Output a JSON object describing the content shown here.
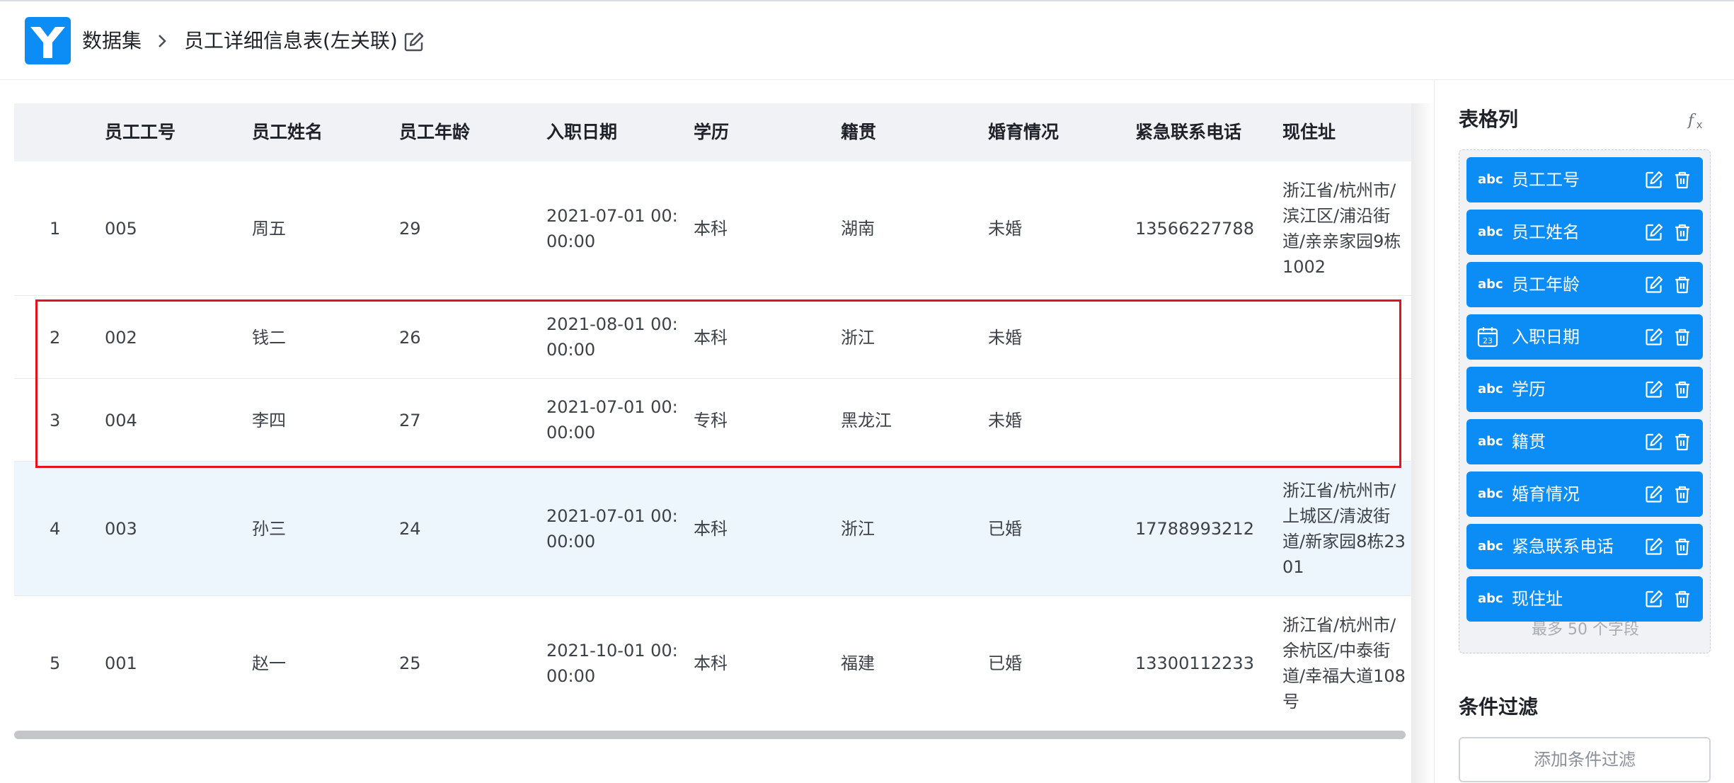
{
  "breadcrumb": {
    "root": "数据集",
    "title": "员工详细信息表(左关联)"
  },
  "table": {
    "columns": [
      "员工工号",
      "员工姓名",
      "员工年龄",
      "入职日期",
      "学历",
      "籍贯",
      "婚育情况",
      "紧急联系电话",
      "现住址"
    ],
    "rows": [
      {
        "index": "1",
        "id": "005",
        "name": "周五",
        "age": "29",
        "date": [
          "2021-07-01 00:",
          "00:00"
        ],
        "edu": "本科",
        "origin": "湖南",
        "marital": "未婚",
        "phone": "13566227788",
        "address": [
          "浙江省/杭州市/",
          "滨江区/浦沿街",
          "道/亲亲家园9栋",
          "1002"
        ],
        "highlighted": false
      },
      {
        "index": "2",
        "id": "002",
        "name": "钱二",
        "age": "26",
        "date": [
          "2021-08-01 00:",
          "00:00"
        ],
        "edu": "本科",
        "origin": "浙江",
        "marital": "未婚",
        "phone": "",
        "address": [],
        "highlighted": false
      },
      {
        "index": "3",
        "id": "004",
        "name": "李四",
        "age": "27",
        "date": [
          "2021-07-01 00:",
          "00:00"
        ],
        "edu": "专科",
        "origin": "黑龙江",
        "marital": "未婚",
        "phone": "",
        "address": [],
        "highlighted": false
      },
      {
        "index": "4",
        "id": "003",
        "name": "孙三",
        "age": "24",
        "date": [
          "2021-07-01 00:",
          "00:00"
        ],
        "edu": "本科",
        "origin": "浙江",
        "marital": "已婚",
        "phone": "17788993212",
        "address": [
          "浙江省/杭州市/",
          "上城区/清波街",
          "道/新家园8栋23",
          "01"
        ],
        "highlighted": true
      },
      {
        "index": "5",
        "id": "001",
        "name": "赵一",
        "age": "25",
        "date": [
          "2021-10-01 00:",
          "00:00"
        ],
        "edu": "本科",
        "origin": "福建",
        "marital": "已婚",
        "phone": "13300112233",
        "address": [
          "浙江省/杭州市/",
          "余杭区/中泰街",
          "道/幸福大道108",
          "号"
        ],
        "highlighted": false
      }
    ]
  },
  "panel": {
    "columns_title": "表格列",
    "fields": [
      {
        "type": "abc",
        "name": "员工工号"
      },
      {
        "type": "abc",
        "name": "员工姓名"
      },
      {
        "type": "abc",
        "name": "员工年龄"
      },
      {
        "type": "calendar",
        "name": "入职日期"
      },
      {
        "type": "abc",
        "name": "学历"
      },
      {
        "type": "abc",
        "name": "籍贯"
      },
      {
        "type": "abc",
        "name": "婚育情况"
      },
      {
        "type": "abc",
        "name": "紧急联系电话"
      },
      {
        "type": "abc",
        "name": "现住址"
      }
    ],
    "limit_text": "最多 50 个字段",
    "filter_title": "条件过滤",
    "add_filter_label": "添加条件过滤"
  },
  "colors": {
    "accent": "#0c8cf5",
    "highlight_row": "#edf6fd",
    "annotation_box": "#e0131f",
    "header_bg": "#f0f2f5"
  }
}
